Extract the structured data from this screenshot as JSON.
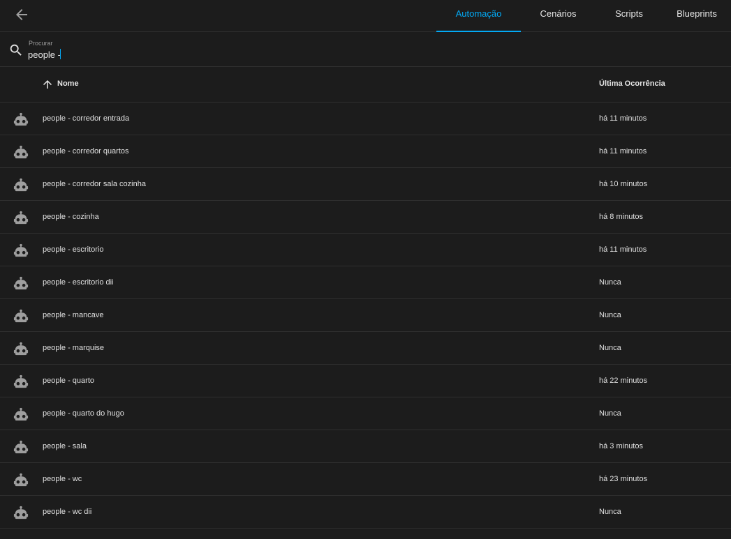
{
  "colors": {
    "background": "#1c1c1c",
    "accent": "#03a9f4",
    "divider": "#2f2f2f",
    "text": "#e1e1e1",
    "icon": "#9e9e9e"
  },
  "header": {
    "back_icon": "arrow-left-icon",
    "tabs": [
      {
        "label": "Automação",
        "active": true
      },
      {
        "label": "Cenários",
        "active": false
      },
      {
        "label": "Scripts",
        "active": false
      },
      {
        "label": "Blueprints",
        "active": false
      }
    ]
  },
  "search": {
    "icon": "magnify-icon",
    "label": "Procurar",
    "value": "people -"
  },
  "table": {
    "sort_icon": "arrow-up-icon",
    "columns": {
      "name": "Nome",
      "last_triggered": "Última Ocorrência"
    },
    "row_icon": "robot-icon",
    "rows": [
      {
        "name": "people - corredor entrada",
        "last": "há 11 minutos"
      },
      {
        "name": "people - corredor quartos",
        "last": "há 11 minutos"
      },
      {
        "name": "people - corredor sala cozinha",
        "last": "há 10 minutos"
      },
      {
        "name": "people - cozinha",
        "last": "há 8 minutos"
      },
      {
        "name": "people - escritorio",
        "last": "há 11 minutos"
      },
      {
        "name": "people - escritorio dii",
        "last": "Nunca"
      },
      {
        "name": "people - mancave",
        "last": "Nunca"
      },
      {
        "name": "people - marquise",
        "last": "Nunca"
      },
      {
        "name": "people - quarto",
        "last": "há 22 minutos"
      },
      {
        "name": "people - quarto do hugo",
        "last": "Nunca"
      },
      {
        "name": "people - sala",
        "last": "há 3 minutos"
      },
      {
        "name": "people - wc",
        "last": "há 23 minutos"
      },
      {
        "name": "people - wc dii",
        "last": "Nunca"
      }
    ]
  }
}
